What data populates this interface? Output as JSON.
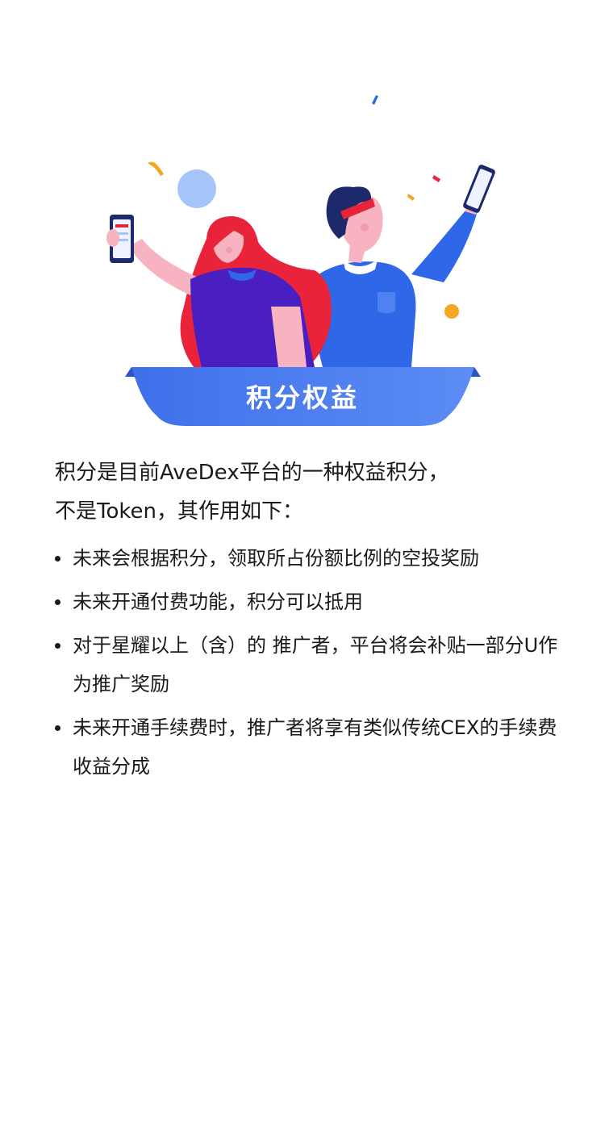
{
  "banner": {
    "title": "积分权益"
  },
  "intro": {
    "line1": "积分是目前AveDex平台的一种权益积分，",
    "line2": "不是Token，其作用如下："
  },
  "benefits": [
    {
      "text": "未来会根据积分，领取所占份额比例的空投奖励"
    },
    {
      "text": "未来开通付费功能，积分可以抵用"
    },
    {
      "text": "对于星耀以上（含）的 推广者，平台将会补贴一部分U作为推广奖励"
    },
    {
      "text": "未来开通手续费时，推广者将享有类似传统CEX的手续费收益分成"
    }
  ],
  "colors": {
    "banner_blue": "#4f7ff0",
    "banner_blue_dark": "#3a66df",
    "man_shirt": "#2e67e8",
    "woman_hair": "#e8233a",
    "woman_shirt": "#4a1fc2",
    "skin": "#f7b4c0",
    "confetti_yellow": "#f5a623"
  },
  "icons": {
    "bullet": "bullet-dot",
    "illustration": "celebrating-couple-illustration"
  }
}
